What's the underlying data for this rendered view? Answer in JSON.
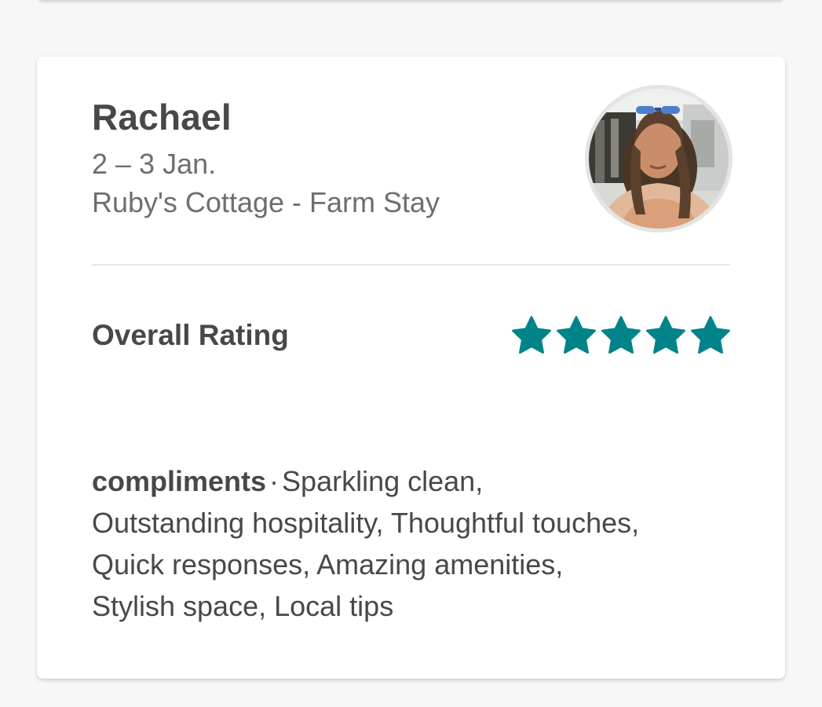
{
  "review": {
    "guest_name": "Rachael",
    "dates": "2 – 3 Jan.",
    "listing": "Ruby's Cottage - Farm Stay",
    "rating_label": "Overall Rating",
    "rating_value": 5,
    "rating_max": 5,
    "compliments_label": "compliments",
    "separator": "·",
    "compliments_text": "Sparkling clean, Outstanding hospitality, Thoughtful touches, Quick responses, Amazing amenities, Stylish space, Local tips"
  },
  "colors": {
    "star": "#008489",
    "text_primary": "#484848",
    "text_secondary": "#6e6e6e"
  },
  "icons": {
    "avatar": "guest-avatar-photo",
    "star": "star-icon"
  }
}
